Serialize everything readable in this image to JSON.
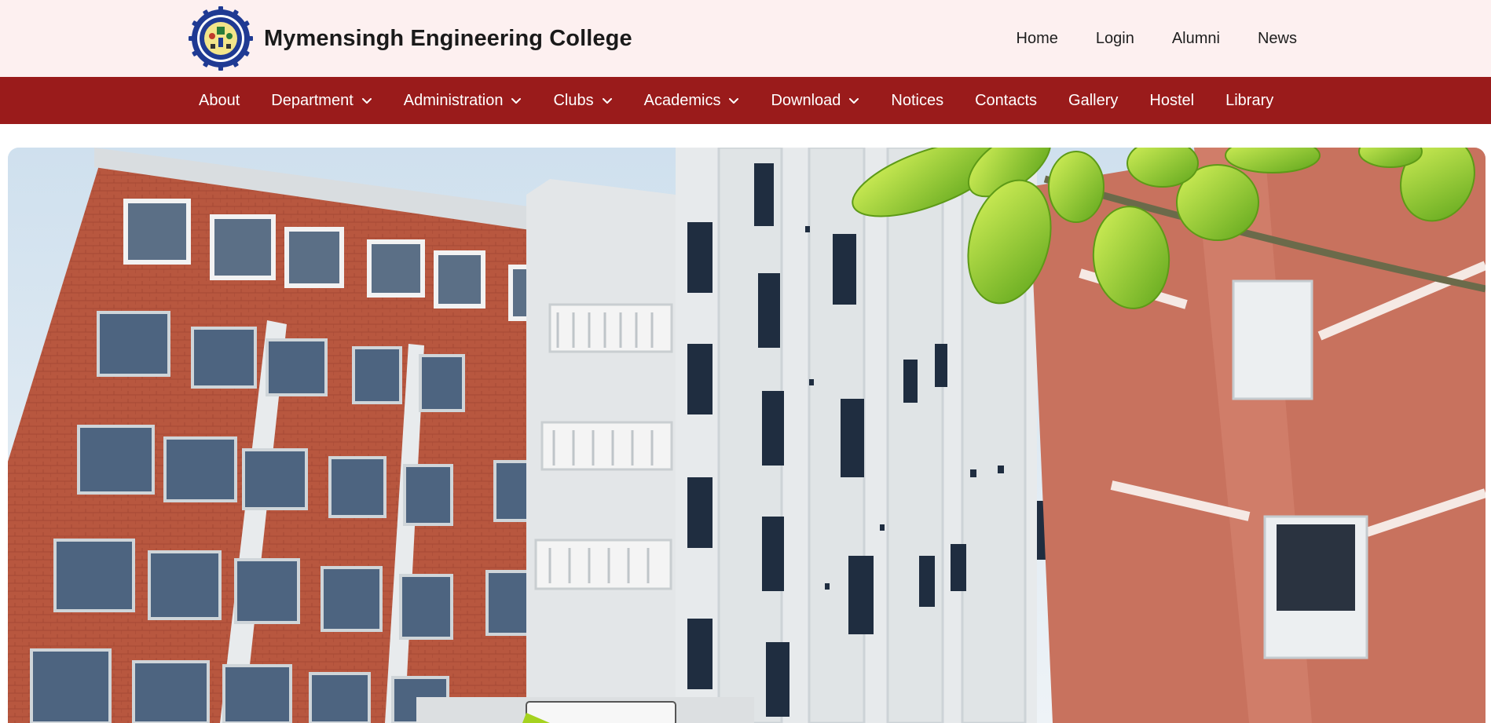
{
  "header": {
    "site_title": "Mymensingh Engineering College",
    "logo_icon": "college-seal-icon",
    "top_links": [
      {
        "label": "Home"
      },
      {
        "label": "Login"
      },
      {
        "label": "Alumni"
      },
      {
        "label": "News"
      }
    ]
  },
  "nav": {
    "items": [
      {
        "label": "About",
        "dropdown": false
      },
      {
        "label": "Department",
        "dropdown": true
      },
      {
        "label": "Administration",
        "dropdown": true
      },
      {
        "label": "Clubs",
        "dropdown": true
      },
      {
        "label": "Academics",
        "dropdown": true
      },
      {
        "label": "Download",
        "dropdown": true
      },
      {
        "label": "Notices",
        "dropdown": false
      },
      {
        "label": "Contacts",
        "dropdown": false
      },
      {
        "label": "Gallery",
        "dropdown": false
      },
      {
        "label": "Hostel",
        "dropdown": false
      },
      {
        "label": "Library",
        "dropdown": false
      }
    ],
    "dropdown_icon": "chevron-down-icon"
  },
  "hero": {
    "subject": "college-building-photo"
  },
  "colors": {
    "header_bg": "#fdf0f0",
    "nav_bg": "#9a1b1b",
    "nav_text": "#ffffff",
    "brick": "#b5553f",
    "facade_white": "#e9ecee",
    "terracotta": "#c8725e",
    "leaf_green": "#8fd12a"
  }
}
